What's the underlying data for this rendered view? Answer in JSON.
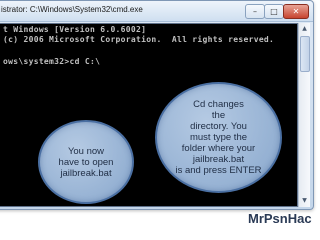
{
  "window": {
    "title": "istrator: C:\\Windows\\System32\\cmd.exe",
    "controls": {
      "minimize": "–",
      "maximize": "□",
      "close": "✕"
    }
  },
  "console": {
    "lines": [
      "t Windows [Version 6.0.6002]",
      "(c) 2006 Microsoft Corporation.  All rights reserved.",
      "ows\\system32>cd C:\\"
    ],
    "background": "#000000",
    "text_color": "#c0c0c0"
  },
  "scrollbar": {
    "up_arrow": "▲",
    "down_arrow": "▼"
  },
  "annotations": {
    "left_bubble": "You now\nhave to open\njailbreak.bat",
    "right_bubble": "Cd changes\nthe\ndirectory. You\nmust type the\nfolder where your\njailbreak.bat\nis and press ENTER",
    "bubble_color": "#9fb9da",
    "bubble_border": "#4a6fa2"
  },
  "watermark": "MrPsnHac"
}
